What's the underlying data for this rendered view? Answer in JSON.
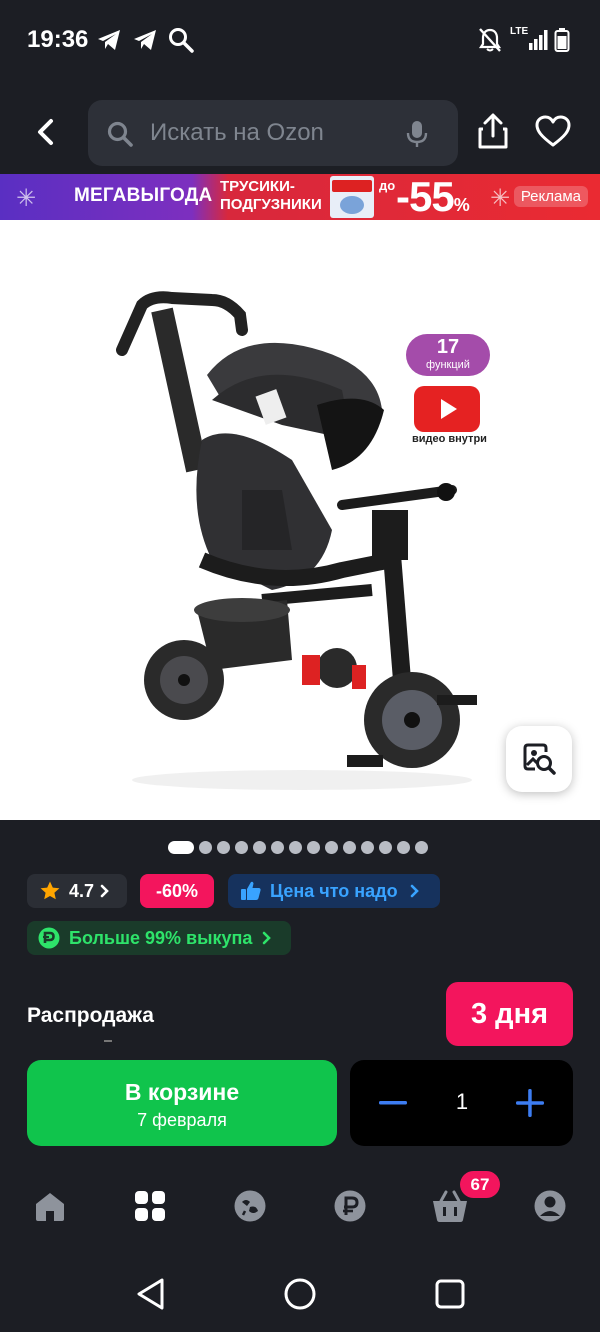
{
  "status_bar": {
    "time": "19:36",
    "network": "LTE",
    "icons": [
      "telegram-icon",
      "telegram-icon",
      "search-icon",
      "mute-icon",
      "signal-icon",
      "battery-icon"
    ]
  },
  "header": {
    "search_placeholder": "Искать на Ozon",
    "icons": [
      "back-icon",
      "search-icon",
      "mic-icon",
      "share-icon",
      "heart-icon"
    ]
  },
  "promo_banner": {
    "title": "МЕГАВЫГОДА",
    "subtitle": "ТРУСИКИ-ПОДГУЗНИКИ",
    "prefix": "до",
    "discount": "-55",
    "percent_sign": "%",
    "ad_label": "Реклама",
    "colors": {
      "purple": "#5a2fc2",
      "red": "#ea2a32"
    }
  },
  "gallery": {
    "image_alt": "tricycle-stroller-photo",
    "badge_count": "17",
    "badge_label": "функций",
    "video_label": "видео внутри",
    "total_images": 14,
    "active_index": 0
  },
  "chips": {
    "rating": "4.7",
    "discount": "-60%",
    "price_promo": "Цена что надо",
    "buyout": "Больше 99% выкупа"
  },
  "sale": {
    "label": "Распродажа",
    "days": "3 дня"
  },
  "cart": {
    "title": "В корзине",
    "date": "7 февраля",
    "quantity": "1"
  },
  "bottom_nav": {
    "items": [
      "home-icon",
      "catalog-icon",
      "fresh-icon",
      "payment-icon",
      "cart-icon",
      "profile-icon"
    ],
    "cart_badge": "67"
  },
  "system_nav": [
    "back-triangle-icon",
    "home-circle-icon",
    "recents-square-icon"
  ],
  "colors": {
    "background": "#1c1e24",
    "accent_pink": "#f3155d",
    "accent_green": "#10c44c",
    "accent_blue": "#39a3ff"
  }
}
